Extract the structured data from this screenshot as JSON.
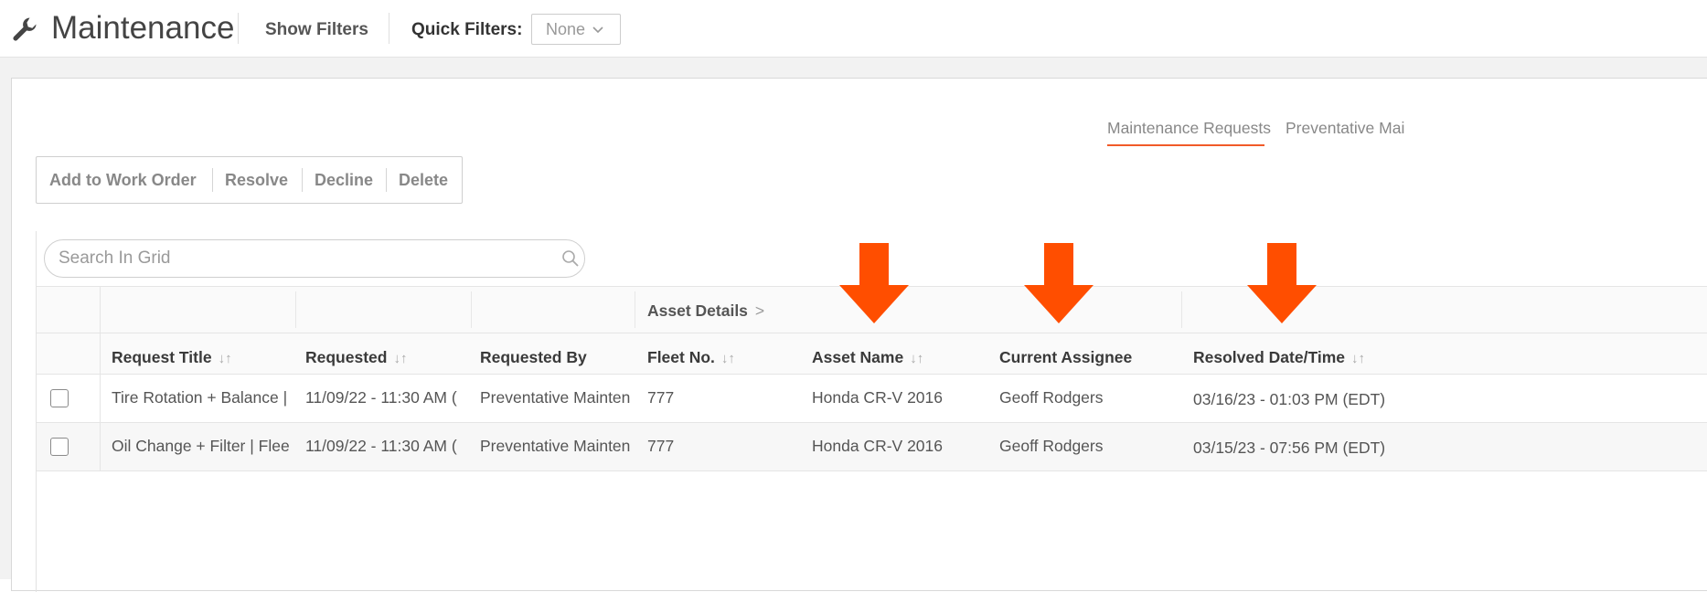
{
  "header": {
    "title": "Maintenance",
    "show_filters": "Show Filters",
    "quick_filters_label": "Quick Filters:",
    "quick_filters_value": "None"
  },
  "tabs": [
    {
      "label": "Maintenance Requests",
      "active": true
    },
    {
      "label": "Preventative Mai",
      "active": false
    }
  ],
  "actions": [
    "Add to Work Order",
    "Resolve",
    "Decline",
    "Delete"
  ],
  "grid": {
    "search_placeholder": "Search In Grid",
    "group_header": "Asset Details",
    "group_arrow": ">",
    "columns": [
      "Request Title",
      "Requested",
      "Requested By",
      "Fleet No.",
      "Asset Name",
      "Current Assignee",
      "Resolved Date/Time"
    ],
    "sort_glyph": "↓↑",
    "rows": [
      {
        "title": "Tire Rotation + Balance |",
        "requested": "11/09/22 - 11:30 AM (",
        "requested_by": "Preventative Mainten",
        "fleet": "777",
        "asset": "Honda CR-V 2016",
        "assignee": "Geoff Rodgers",
        "resolved": "03/16/23 - 01:03 PM (EDT)"
      },
      {
        "title": "Oil Change + Filter | Flee",
        "requested": "11/09/22 - 11:30 AM (",
        "requested_by": "Preventative Mainten",
        "fleet": "777",
        "asset": "Honda CR-V 2016",
        "assignee": "Geoff Rodgers",
        "resolved": "03/15/23 - 07:56 PM (EDT)"
      }
    ]
  },
  "colors": {
    "accent": "#f15a29",
    "annotation_arrow": "#ff4e00"
  }
}
